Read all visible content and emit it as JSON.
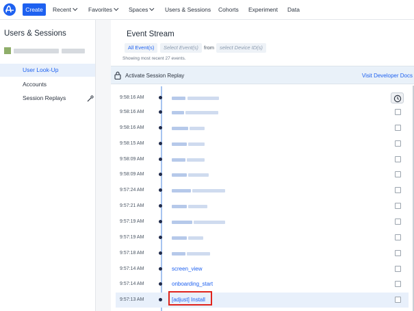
{
  "nav": {
    "create_label": "Create",
    "items": [
      {
        "label": "Recent",
        "dropdown": true
      },
      {
        "label": "Favorites",
        "dropdown": true
      },
      {
        "label": "Spaces",
        "dropdown": true
      },
      {
        "label": "Users & Sessions",
        "dropdown": false
      },
      {
        "label": "Cohorts",
        "dropdown": false
      },
      {
        "label": "Experiment",
        "dropdown": false
      },
      {
        "label": "Data",
        "dropdown": false
      }
    ],
    "logo_icon": "amplitude-logo-icon",
    "accent": "#1e61f0"
  },
  "sidebar": {
    "title": "Users & Sessions",
    "items": [
      {
        "label": "User Look-Up",
        "active": true
      },
      {
        "label": "Accounts",
        "active": false
      },
      {
        "label": "Session Replays",
        "active": false
      }
    ],
    "session_replays_icon": "wand-icon"
  },
  "main": {
    "title": "Event Stream",
    "filter_all_events": "All Event(s)",
    "filter_select_event": "Select Event(s)",
    "filter_from": "from",
    "filter_select_device": "select Device ID(s)",
    "showing_text": "Showing most recent 27 events.",
    "replay_label": "Activate Session Replay",
    "replay_icon": "lock-icon",
    "dev_docs_link": "Visit Developer Docs",
    "clock_icon": "clock-icon",
    "events": [
      {
        "time": "9:58:16 AM",
        "name": null
      },
      {
        "time": "9:58:16 AM",
        "name": null
      },
      {
        "time": "9:58:16 AM",
        "name": null
      },
      {
        "time": "9:58:15 AM",
        "name": null
      },
      {
        "time": "9:58:09 AM",
        "name": null
      },
      {
        "time": "9:58:09 AM",
        "name": null
      },
      {
        "time": "9:57:24 AM",
        "name": null
      },
      {
        "time": "9:57:21 AM",
        "name": null
      },
      {
        "time": "9:57:19 AM",
        "name": null
      },
      {
        "time": "9:57:19 AM",
        "name": null
      },
      {
        "time": "9:57:18 AM",
        "name": null
      },
      {
        "time": "9:57:14 AM",
        "name": "screen_view"
      },
      {
        "time": "9:57:14 AM",
        "name": "onboarding_start"
      },
      {
        "time": "9:57:13 AM",
        "name": "[adjust] Install",
        "highlighted": true
      }
    ],
    "highlight_border_color": "#e0231b"
  }
}
